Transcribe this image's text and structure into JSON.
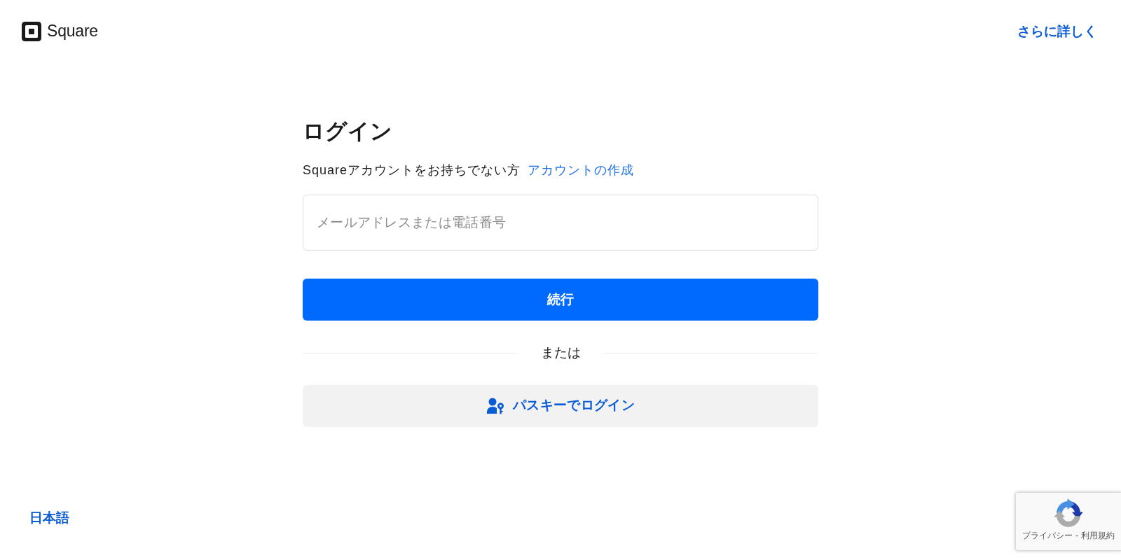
{
  "header": {
    "logo": "Square",
    "learn_more_link": "さらに詳しく"
  },
  "login": {
    "title": "ログイン",
    "prompt": "Squareアカウントをお持ちでない方",
    "create_account_link": "アカウントの作成",
    "identifier_field": {
      "placeholder": "メールアドレスまたは電話番号"
    },
    "continue_button": "続行",
    "divider": "または",
    "passkey_button": "パスキーでログイン"
  },
  "footer": {
    "language_link": "日本語"
  },
  "recaptcha_badge": {
    "links": [
      "プライバシー",
      "利用規約"
    ],
    "separator": "-"
  }
}
